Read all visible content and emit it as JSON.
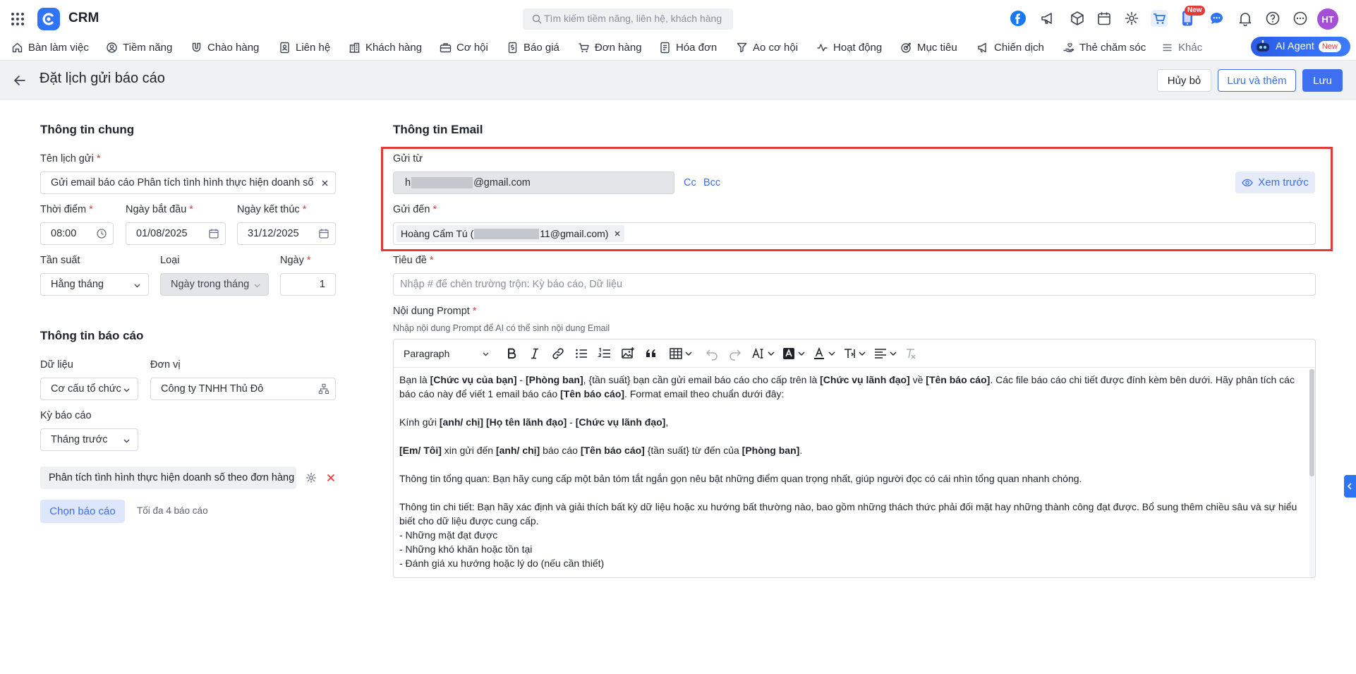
{
  "app": {
    "name": "CRM",
    "user_initials": "HT",
    "new_badge": "New"
  },
  "search": {
    "placeholder": "Tìm kiếm tiềm năng, liên hệ, khách hàng"
  },
  "nav": {
    "items": [
      "Bàn làm việc",
      "Tiềm năng",
      "Chào hàng",
      "Liên hệ",
      "Khách hàng",
      "Cơ hội",
      "Báo giá",
      "Đơn hàng",
      "Hóa đơn",
      "Ao cơ hội",
      "Hoạt động",
      "Mục tiêu",
      "Chiến dịch",
      "Thẻ chăm sóc",
      "Khác"
    ],
    "ai_agent": "AI Agent",
    "ai_badge": "New"
  },
  "page": {
    "title": "Đặt lịch gửi báo cáo",
    "cancel": "Hủy bỏ",
    "save_add": "Lưu và thêm",
    "save": "Lưu"
  },
  "general": {
    "title": "Thông tin chung",
    "name_label": "Tên lịch gửi",
    "name_value": "Gửi email báo cáo Phân tích tình hình thực hiện doanh số theo",
    "time_label": "Thời điểm",
    "time_value": "08:00",
    "start_label": "Ngày bắt đầu",
    "start_value": "01/08/2025",
    "end_label": "Ngày kết thúc",
    "end_value": "31/12/2025",
    "freq_label": "Tần suất",
    "freq_value": "Hằng tháng",
    "type_label": "Loại",
    "type_value": "Ngày trong tháng",
    "day_label": "Ngày",
    "day_value": "1"
  },
  "report": {
    "title": "Thông tin báo cáo",
    "data_label": "Dữ liệu",
    "data_value": "Cơ cấu tổ chức",
    "unit_label": "Đơn vị",
    "unit_value": "Công ty TNHH Thủ Đô",
    "period_label": "Kỳ báo cáo",
    "period_value": "Tháng trước",
    "selected_report": "Phân tích tình hình thực hiện doanh số theo đơn hàng",
    "choose_btn": "Chọn báo cáo",
    "max_hint": "Tối đa 4 báo cáo"
  },
  "email": {
    "title": "Thông tin Email",
    "from_label": "Gửi từ",
    "from_prefix": "h",
    "from_suffix": "@gmail.com",
    "cc": "Cc",
    "bcc": "Bcc",
    "preview": "Xem trước",
    "to_label": "Gửi đến",
    "to_name": "Hoàng Cẩm Tú (",
    "to_suffix": "11@gmail.com)",
    "subject_label": "Tiêu đề",
    "subject_placeholder": "Nhập # để chèn trường trộn: Kỳ báo cáo, Dữ liệu",
    "prompt_label": "Nội dung Prompt",
    "prompt_hint": "Nhập nội dung Prompt để AI có thể sinh nội dung Email",
    "paragraph_select": "Paragraph"
  },
  "prompt": {
    "p1_a": "Bạn là ",
    "p1_b": "[Chức vụ của bạn]",
    "p1_c": " - ",
    "p1_d": "[Phòng ban]",
    "p1_e": ", {tần suất} bạn cần gửi email báo cáo cho cấp trên là ",
    "p1_f": "[Chức vụ lãnh đạo]",
    "p1_g": " về ",
    "p1_h": "[Tên báo cáo]",
    "p1_i": ". Các file báo cáo chi tiết được đính kèm bên dưới. Hãy phân tích các báo cáo này để viết 1 email báo cáo ",
    "p1_j": "[Tên báo cáo]",
    "p1_k": ". Format email theo chuẩn dưới đây:",
    "p2_a": "Kính gửi ",
    "p2_b": "[anh/ chị] [Họ tên lãnh đạo]",
    "p2_c": " - ",
    "p2_d": "[Chức vụ lãnh đạo]",
    "p2_e": ",",
    "p3_a": "[Em/ Tôi]",
    "p3_b": " xin gửi đến ",
    "p3_c": "[anh/ chị]",
    "p3_d": " báo cáo ",
    "p3_e": "[Tên báo cáo]",
    "p3_f": " {tần suất} từ đến của ",
    "p3_g": "[Phòng ban]",
    "p3_h": ".",
    "p4": "Thông tin tổng quan: Bạn hãy cung cấp một bản tóm tắt ngắn gọn nêu bật những điểm quan trọng nhất, giúp người đọc có cái nhìn tổng quan nhanh chóng.",
    "p5": "Thông tin chi tiết: Bạn hãy xác định và giải thích bất kỳ dữ liệu hoặc xu hướng bất thường nào, bao gồm những thách thức phải đối mặt hay những thành công đạt được. Bổ sung thêm chiều sâu và sự hiểu biết cho dữ liệu được cung cấp.",
    "l1": "- Những mặt đạt được",
    "l2": "- Những khó khăn hoặc tồn tại",
    "l3": "- Đánh giá xu hướng hoặc lý do (nếu cần thiết)"
  }
}
